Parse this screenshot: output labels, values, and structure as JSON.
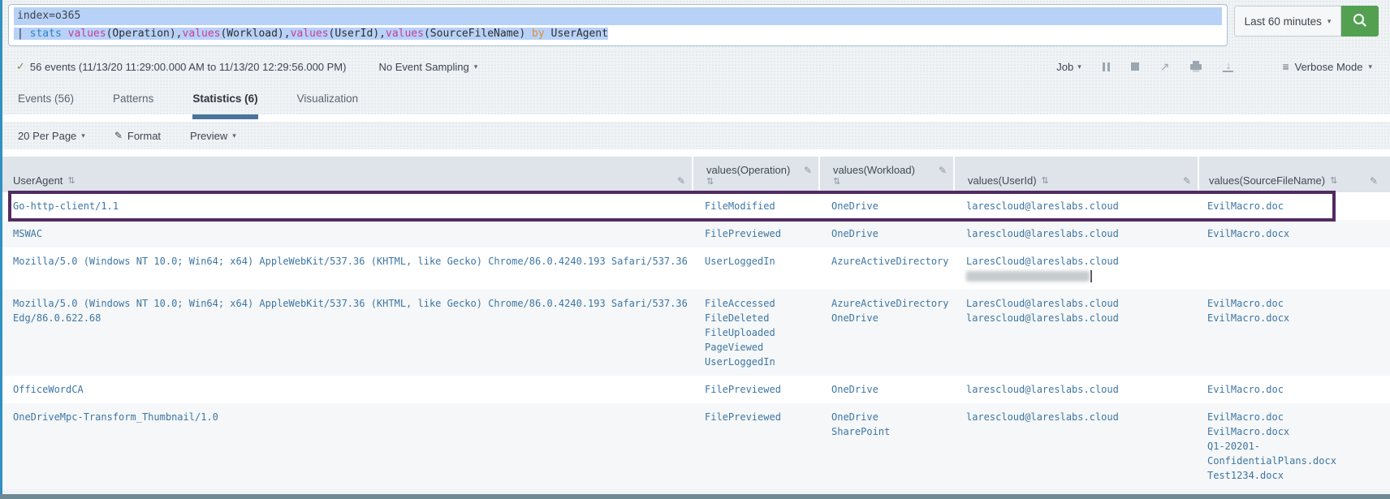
{
  "colors": {
    "accent_green": "#53a051",
    "selection": "#b8d2f7",
    "annotation": "#532a61",
    "cell_text": "#3e76a3",
    "header_bg": "#dee4e9",
    "tab_underline": "#49759b",
    "left_accent": "#3090bf",
    "bottom_strip": "#6e8894"
  },
  "icons": {
    "caret": "▾",
    "sort": "⇅",
    "edit": "✎",
    "check": "✓",
    "menu": "≡",
    "share": "↗",
    "download_arrow": "↓"
  },
  "search": {
    "query_line1": "index=o365",
    "query_line2_tokens": [
      {
        "text": "| ",
        "type": "plain"
      },
      {
        "text": "stats",
        "type": "command"
      },
      {
        "text": " ",
        "type": "plain"
      },
      {
        "text": "values",
        "type": "function"
      },
      {
        "text": "(Operation),",
        "type": "plain"
      },
      {
        "text": "values",
        "type": "function"
      },
      {
        "text": "(Workload),",
        "type": "plain"
      },
      {
        "text": "values",
        "type": "function"
      },
      {
        "text": "(UserId),",
        "type": "plain"
      },
      {
        "text": "values",
        "type": "function"
      },
      {
        "text": "(SourceFileName)",
        "type": "plain"
      },
      {
        "text": " ",
        "type": "plain"
      },
      {
        "text": "by",
        "type": "modifier"
      },
      {
        "text": " UserAgent",
        "type": "plain"
      }
    ],
    "time_range_label": "Last 60 minutes"
  },
  "info_bar": {
    "events_summary": "56 events (11/13/20 11:29:00.000 AM to 11/13/20 12:29:56.000 PM)",
    "sampling_label": "No Event Sampling",
    "job_label": "Job",
    "verbose_label": "Verbose Mode"
  },
  "tabs": [
    {
      "id": "events",
      "label": "Events (56)",
      "active": false
    },
    {
      "id": "patterns",
      "label": "Patterns",
      "active": false
    },
    {
      "id": "statistics",
      "label": "Statistics (6)",
      "active": true
    },
    {
      "id": "visualization",
      "label": "Visualization",
      "active": false
    }
  ],
  "toolbar": {
    "per_page_label": "20 Per Page",
    "format_label": "Format",
    "preview_label": "Preview"
  },
  "table": {
    "columns": [
      {
        "key": "useragent",
        "label": "UserAgent",
        "stacked": false
      },
      {
        "key": "operation",
        "label": "values(Operation)",
        "stacked": true
      },
      {
        "key": "workload",
        "label": "values(Workload)",
        "stacked": true
      },
      {
        "key": "userid",
        "label": "values(UserId)",
        "stacked": false
      },
      {
        "key": "sourcefile",
        "label": "values(SourceFileName)",
        "stacked": false
      }
    ],
    "rows": [
      {
        "annotated": true,
        "useragent": [
          "Go-http-client/1.1"
        ],
        "operation": [
          "FileModified"
        ],
        "workload": [
          "OneDrive"
        ],
        "userid": [
          "larescloud@lareslabs.cloud"
        ],
        "sourcefile": [
          "EvilMacro.doc"
        ]
      },
      {
        "useragent": [
          "MSWAC"
        ],
        "operation": [
          "FilePreviewed"
        ],
        "workload": [
          "OneDrive"
        ],
        "userid": [
          "larescloud@lareslabs.cloud"
        ],
        "sourcefile": [
          "EvilMacro.docx"
        ]
      },
      {
        "useragent": [
          "Mozilla/5.0 (Windows NT 10.0; Win64; x64) AppleWebKit/537.36 (KHTML, like Gecko) Chrome/86.0.4240.193 Safari/537.36"
        ],
        "operation": [
          "UserLoggedIn"
        ],
        "workload": [
          "AzureActiveDirectory"
        ],
        "userid": [
          "LaresCloud@lareslabs.cloud",
          {
            "redacted": true
          }
        ],
        "sourcefile": []
      },
      {
        "useragent": [
          "Mozilla/5.0 (Windows NT 10.0; Win64; x64) AppleWebKit/537.36 (KHTML, like Gecko) Chrome/86.0.4240.193 Safari/537.36",
          "Edg/86.0.622.68"
        ],
        "operation": [
          "FileAccessed",
          "FileDeleted",
          "FileUploaded",
          "PageViewed",
          "UserLoggedIn"
        ],
        "workload": [
          "AzureActiveDirectory",
          "OneDrive"
        ],
        "userid": [
          "LaresCloud@lareslabs.cloud",
          "larescloud@lareslabs.cloud"
        ],
        "sourcefile": [
          "EvilMacro.doc",
          "EvilMacro.docx"
        ]
      },
      {
        "useragent": [
          "OfficeWordCA"
        ],
        "operation": [
          "FilePreviewed"
        ],
        "workload": [
          "OneDrive"
        ],
        "userid": [
          "larescloud@lareslabs.cloud"
        ],
        "sourcefile": [
          "EvilMacro.doc"
        ]
      },
      {
        "useragent": [
          "OneDriveMpc-Transform_Thumbnail/1.0"
        ],
        "operation": [
          "FilePreviewed"
        ],
        "workload": [
          "OneDrive",
          "SharePoint"
        ],
        "userid": [
          "larescloud@lareslabs.cloud"
        ],
        "sourcefile": [
          "EvilMacro.doc",
          "EvilMacro.docx",
          "Q1-20201-ConfidentialPlans.docx",
          "Test1234.docx"
        ]
      }
    ]
  }
}
